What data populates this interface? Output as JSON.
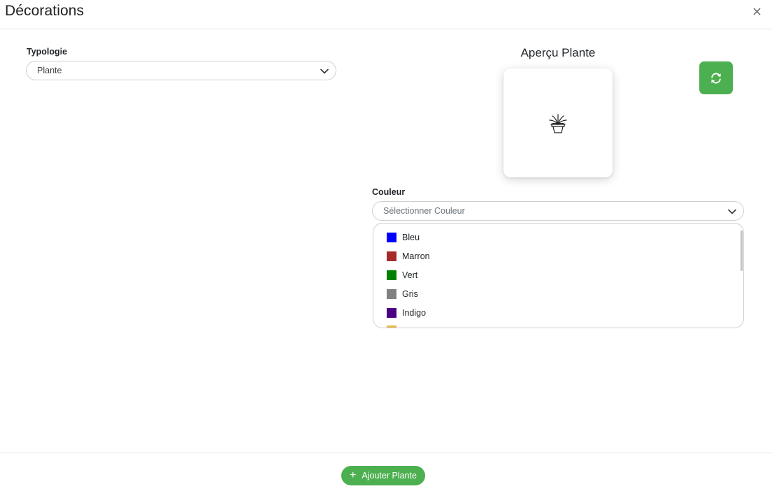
{
  "modal": {
    "title": "Décorations"
  },
  "typologie": {
    "label": "Typologie",
    "value": "Plante"
  },
  "preview": {
    "title": "Aperçu Plante",
    "icon": "plant-pot-icon"
  },
  "refresh": {
    "icon": "refresh-icon",
    "color": "#4caf50"
  },
  "couleur": {
    "label": "Couleur",
    "placeholder": "Sélectionner Couleur",
    "options": [
      {
        "label": "Bleu",
        "color": "#0000ff"
      },
      {
        "label": "Marron",
        "color": "#a52a2a"
      },
      {
        "label": "Vert",
        "color": "#008000"
      },
      {
        "label": "Gris",
        "color": "#808080"
      },
      {
        "label": "Indigo",
        "color": "#4b0082"
      },
      {
        "label": "",
        "color": "#e8b84a"
      }
    ]
  },
  "footer": {
    "add_label": "Ajouter Plante"
  }
}
